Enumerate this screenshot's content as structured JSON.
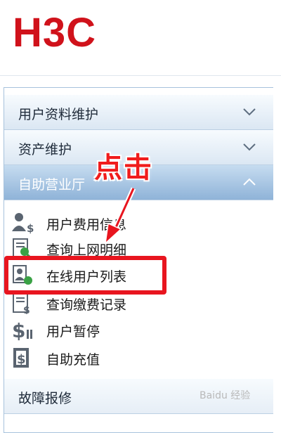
{
  "brand": {
    "logo_text": "H3C"
  },
  "menu": {
    "sections": [
      {
        "label": "用户资料维护",
        "state": "collapsed"
      },
      {
        "label": "资产维护",
        "state": "collapsed"
      },
      {
        "label": "自助营业厅",
        "state": "expanded"
      },
      {
        "label": "故障报修",
        "state": "collapsed"
      }
    ],
    "self_service_items": [
      {
        "label": "用户费用信息",
        "icon": "users-money-icon"
      },
      {
        "label": "查询上网明细",
        "icon": "search-document-icon"
      },
      {
        "label": "在线用户列表",
        "icon": "online-users-icon"
      },
      {
        "label": "查询缴费记录",
        "icon": "payment-record-icon"
      },
      {
        "label": "用户暂停",
        "icon": "dollar-pause-icon"
      },
      {
        "label": "自助充值",
        "icon": "recharge-icon"
      }
    ]
  },
  "annotation": {
    "text": "点击",
    "color": "#f01c1c"
  },
  "watermark": {
    "text": "Baidu 经验"
  },
  "colors": {
    "brand": "#d0121b",
    "highlight": "#e8151f",
    "header_active": "#8fb3d8"
  }
}
